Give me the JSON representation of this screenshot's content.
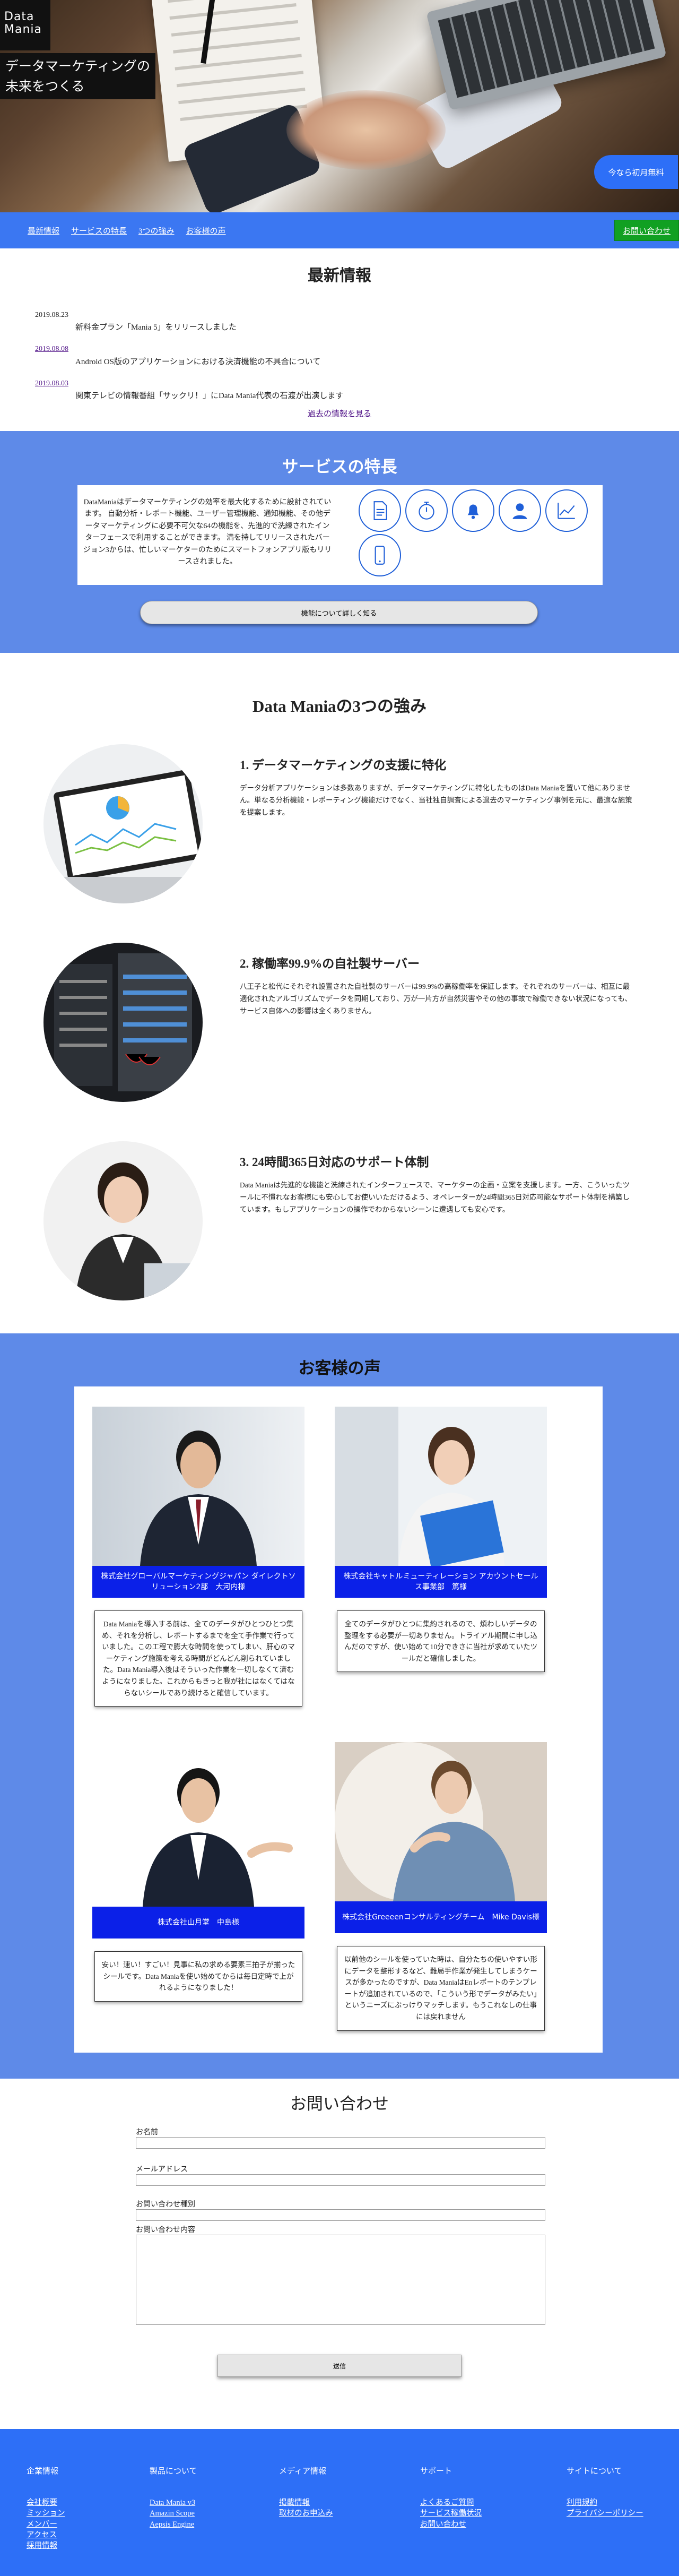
{
  "brand": {
    "logo_line1": "Data",
    "logo_line2": "Mania"
  },
  "hero": {
    "tagline_line1": "データマーケティングの",
    "tagline_line2": "未来をつくる",
    "cta": "今なら初月無料"
  },
  "nav": {
    "items": [
      "最新情報",
      "サービスの特長",
      "3つの強み",
      "お客様の声"
    ],
    "contact": "お問い合わせ"
  },
  "news": {
    "title": "最新情報",
    "items": [
      {
        "date": "2019.08.23",
        "text": "新料金プラン「Mania 5」をリリースしました"
      },
      {
        "date": "2019.08.08",
        "text": "Android OS版のアプリケーションにおける決済機能の不具合について"
      },
      {
        "date": "2019.08.03",
        "text": "関東テレビの情報番組「サックリ！」にData Mania代表の石渡が出演します"
      }
    ],
    "more": "過去の情報を見る"
  },
  "services": {
    "title": "サービスの特長",
    "description": "DataManiaはデータマーケティングの効率を最大化するために設計されています。 自動分析・レポート機能、ユーザー管理機能、通知機能、その他データマーケティングに必要不可欠な64の機能を、先進的で洗練されたインターフェースで利用することができます。 満を持してリリースされたバージョン3からは、忙しいマーケターのためにスマートフォンアプリ版もリリースされました。",
    "icons": [
      "document-icon",
      "stopwatch-icon",
      "bell-icon",
      "user-icon",
      "line-chart-icon",
      "smartphone-icon"
    ],
    "button": "機能について詳しく知る"
  },
  "strengths": {
    "title": "Data Maniaの3つの強み",
    "items": [
      {
        "heading": "1. データマーケティングの支援に特化",
        "body": "データ分析アプリケーションは多数ありますが、データマーケティングに特化したものはData Maniaを置いて他にありません。単なる分析機能・レポーティング機能だけでなく、当社独自調査による過去のマーケティング事例を元に、最適な施策を提案します。"
      },
      {
        "heading": "2. 稼働率99.9%の自社製サーバー",
        "body": "八王子と松代にそれぞれ設置された自社製のサーバーは99.9%の高稼働率を保証します。それぞれのサーバーは、相互に最適化されたアルゴリズムでデータを同期しており、万が一片方が自然災害やその他の事故で稼働できない状況になっても、サービス自体への影響は全くありません。"
      },
      {
        "heading": "3. 24時間365日対応のサポート体制",
        "body": "Data Maniaは先進的な機能と洗練されたインターフェースで、マーケターの企画・立案を支援します。一方、こういったツールに不慣れなお客様にも安心してお使いいただけるよう、オペレーターが24時間365日対応可能なサポート体制を構築しています。もしアプリケーションの操作でわからないシーンに遭遇しても安心です。"
      }
    ]
  },
  "voices": {
    "title": "お客様の声",
    "items": [
      {
        "caption": "株式会社グローバルマーケティングジャパン ダイレクトソリューション2部　大河内様",
        "quote": "Data Maniaを導入する前は、全てのデータがひとつひとつ集め、それを分析し、レポートするまでを全て手作業で行っていました。この工程で膨大な時間を使ってしまい、肝心のマーケティング施策を考える時間がどんどん削られていました。Data Mania導入後はそういった作業を一切しなくて済むようになりました。これからもきっと我が社にはなくてはならないシールであり続けると確信しています。"
      },
      {
        "caption": "株式会社キャトルミューティレーション アカウントセールス事業部　篤様",
        "quote": "全てのデータがひとつに集約されるので、煩わしいデータの整理をする必要が一切ありません。トライアル期間に申し込んだのですが、使い始めて10分できさに当社が求めていたツールだと確信しました。"
      },
      {
        "caption": "株式会社山月堂　中島様",
        "quote": "安い！速い！すごい！見事に私の求める要素三拍子が揃ったシールです。Data Maniaを使い始めてからは毎日定時で上がれるようになりました！"
      },
      {
        "caption": "株式会社Greeeenコンサルティングチーム　Mike Davis様",
        "quote": "以前他のシールを使っていた時は、自分たちの使いやすい形にデータを整形するなど、難局手作業が発生してしまうケースが多かったのですが、Data ManiaはEnレポートのテンプレートが追加されているので、「こういう形でデータがみたい」というニーズにぶっけりマッチします。もうこれなしの仕事には戻れません"
      }
    ]
  },
  "contact": {
    "title": "お問い合わせ",
    "name_label": "お名前",
    "email_label": "メールアドレス",
    "type_label": "お問い合わせ種別",
    "message_label": "お問い合わせ内容",
    "submit": "送信"
  },
  "footer": {
    "columns": [
      {
        "title": "企業情報",
        "links": [
          "会社概要",
          "ミッション",
          "メンバー",
          "アクセス",
          "採用情報"
        ]
      },
      {
        "title": "製品について",
        "links": [
          "Data Mania v3",
          "Amazin Scope",
          "Aepsis Engine"
        ]
      },
      {
        "title": "メディア情報",
        "links": [
          "掲載情報",
          "取材のお申込み"
        ]
      },
      {
        "title": "サポート",
        "links": [
          "よくあるご質問",
          "サービス稼働状況",
          "お問い合わせ"
        ]
      },
      {
        "title": "サイトについて",
        "links": [
          "利用規約",
          "プライバシーポリシー"
        ]
      }
    ]
  },
  "colors": {
    "brand_blue": "#3b77f2",
    "section_blue": "#5e8ae8",
    "cta_green": "#11a022",
    "caption_blue": "#0b20e8"
  }
}
